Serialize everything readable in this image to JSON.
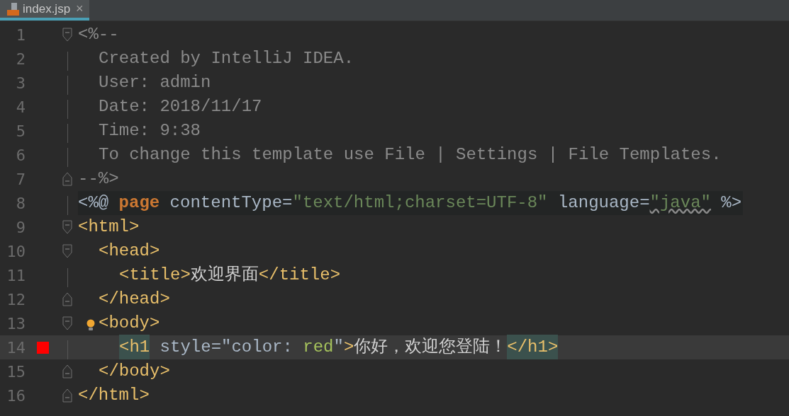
{
  "tabs": [
    {
      "label": "index.jsp",
      "selected": true,
      "close": "×"
    }
  ],
  "lines": [
    {
      "number": "1",
      "kind": "opener",
      "current": false,
      "breakpoint": false,
      "bulb": false,
      "directive": false,
      "tokens": [
        {
          "text": "<%--",
          "kind": "comment"
        }
      ],
      "children": [
        {
          "number": "2",
          "kind": "line",
          "current": false,
          "breakpoint": false,
          "bulb": false,
          "directive": false,
          "tokens": [
            {
              "text": "Created by IntelliJ IDEA.",
              "kind": "comment"
            }
          ]
        },
        {
          "number": "3",
          "kind": "line",
          "current": false,
          "breakpoint": false,
          "bulb": false,
          "directive": false,
          "tokens": [
            {
              "text": "User: admin",
              "kind": "comment"
            }
          ]
        },
        {
          "number": "4",
          "kind": "line",
          "current": false,
          "breakpoint": false,
          "bulb": false,
          "directive": false,
          "tokens": [
            {
              "text": "Date: 2018/11/17",
              "kind": "comment"
            }
          ]
        },
        {
          "number": "5",
          "kind": "line",
          "current": false,
          "breakpoint": false,
          "bulb": false,
          "directive": false,
          "tokens": [
            {
              "text": "Time: 9:38",
              "kind": "comment"
            }
          ]
        },
        {
          "number": "6",
          "kind": "line",
          "current": false,
          "breakpoint": false,
          "bulb": false,
          "directive": false,
          "tokens": [
            {
              "text": "To change this template use File | Settings | File Templates.",
              "kind": "comment"
            }
          ]
        }
      ]
    },
    {
      "number": "7",
      "kind": "closer",
      "current": false,
      "breakpoint": false,
      "bulb": false,
      "directive": false,
      "tokens": [
        {
          "text": "--%>",
          "kind": "comment"
        }
      ]
    },
    {
      "number": "8",
      "kind": "line",
      "current": false,
      "breakpoint": false,
      "bulb": false,
      "directive": true,
      "tokens": [
        {
          "text": "<%@ ",
          "kind": "plain"
        },
        {
          "text": "page",
          "kind": "keyword"
        },
        {
          "text": " contentType=",
          "kind": "plain"
        },
        {
          "text": "\"text/html;charset=UTF-8\"",
          "kind": "string"
        },
        {
          "text": " language=",
          "kind": "plain"
        },
        {
          "text": "\"java\"",
          "kind": "string",
          "warning": true
        },
        {
          "text": " %>",
          "kind": "plain"
        }
      ]
    },
    {
      "number": "9",
      "kind": "opener",
      "current": false,
      "breakpoint": false,
      "bulb": false,
      "directive": false,
      "tokens": [
        {
          "text": "<html>",
          "kind": "tag"
        }
      ],
      "children": [
        {
          "number": "10",
          "kind": "opener",
          "current": false,
          "breakpoint": false,
          "bulb": false,
          "directive": false,
          "tokens": [
            {
              "text": "<head>",
              "kind": "tag"
            }
          ],
          "children": [
            {
              "number": "11",
              "kind": "line",
              "current": false,
              "breakpoint": false,
              "bulb": false,
              "directive": false,
              "tokens": [
                {
                  "text": "<title>",
                  "kind": "tag"
                },
                {
                  "text": "欢迎界面",
                  "kind": "text"
                },
                {
                  "text": "</title>",
                  "kind": "tag"
                }
              ]
            }
          ]
        },
        {
          "number": "12",
          "kind": "closer",
          "current": false,
          "breakpoint": false,
          "bulb": false,
          "directive": false,
          "tokens": [
            {
              "text": "</head>",
              "kind": "tag"
            }
          ]
        },
        {
          "number": "13",
          "kind": "opener",
          "current": false,
          "breakpoint": false,
          "bulb": true,
          "directive": false,
          "tokens": [
            {
              "text": "<body>",
              "kind": "tag"
            }
          ],
          "children": [
            {
              "number": "14",
              "kind": "line",
              "current": true,
              "breakpoint": true,
              "bulb": false,
              "directive": false,
              "tokens": [
                {
                  "text": "<h1",
                  "kind": "tag",
                  "matched": true
                },
                {
                  "text": " style=",
                  "kind": "plain"
                },
                {
                  "text": "\"color: ",
                  "kind": "plain"
                },
                {
                  "text": "red",
                  "kind": "value"
                },
                {
                  "text": "\"",
                  "kind": "plain"
                },
                {
                  "text": ">",
                  "kind": "tag"
                },
                {
                  "text": "你好，欢迎您登陆！",
                  "kind": "text"
                },
                {
                  "text": "</h1>",
                  "kind": "tag",
                  "matched": true
                }
              ]
            }
          ]
        },
        {
          "number": "15",
          "kind": "closer",
          "current": false,
          "breakpoint": false,
          "bulb": false,
          "directive": false,
          "tokens": [
            {
              "text": "</body>",
              "kind": "tag"
            }
          ]
        }
      ]
    },
    {
      "number": "16",
      "kind": "closer",
      "current": false,
      "breakpoint": false,
      "bulb": false,
      "directive": false,
      "tokens": [
        {
          "text": "</html>",
          "kind": "tag"
        }
      ]
    }
  ]
}
